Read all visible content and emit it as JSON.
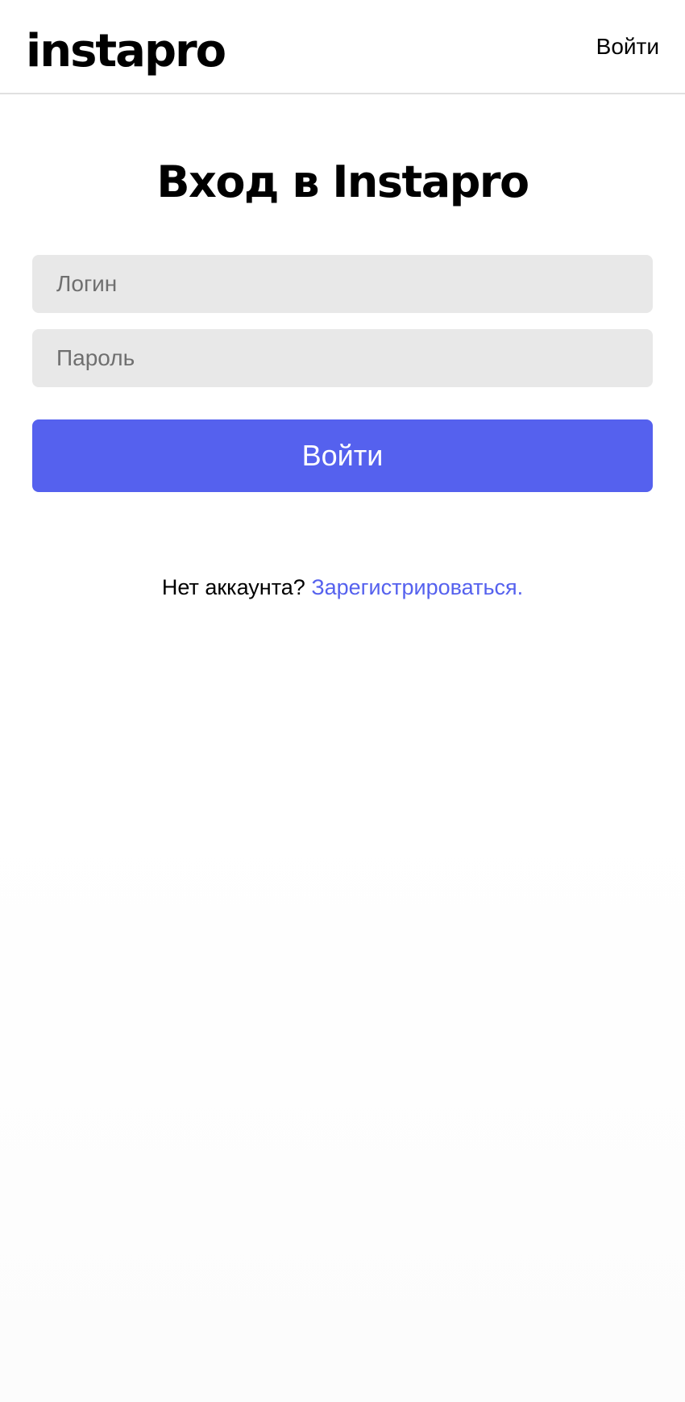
{
  "header": {
    "logo": "instapro",
    "login_link": "Войти"
  },
  "main": {
    "title": "Вход в Instapro",
    "login_field": {
      "placeholder": "Логин",
      "value": ""
    },
    "password_field": {
      "placeholder": "Пароль",
      "value": ""
    },
    "submit_label": "Войти",
    "no_account_text": "Нет аккаунта?",
    "register_link": "Зарегистрироваться."
  },
  "colors": {
    "accent": "#5561ee",
    "input_background": "#e8e8e8",
    "header_border": "#e0e0e0"
  }
}
